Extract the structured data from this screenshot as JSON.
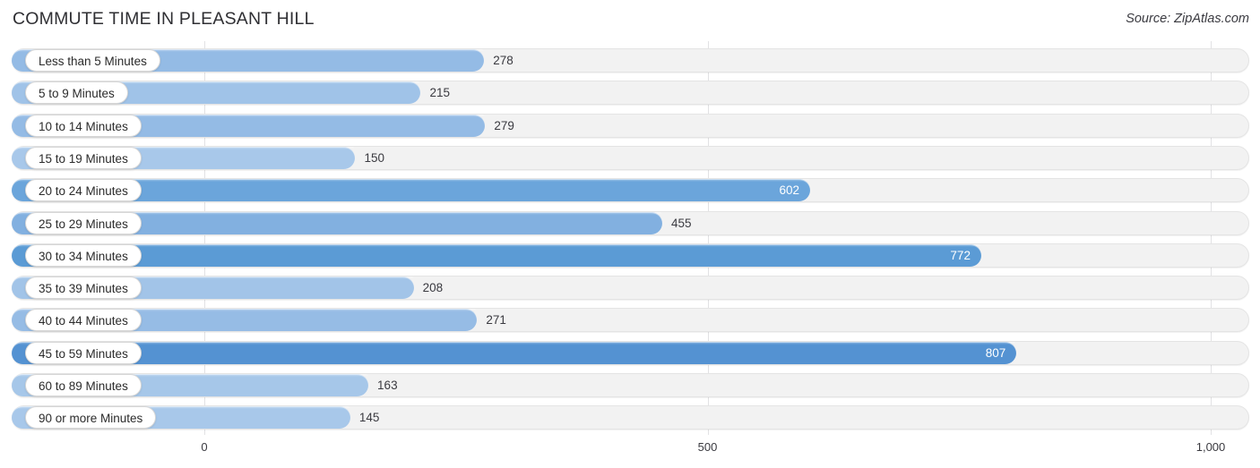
{
  "header": {
    "title": "COMMUTE TIME IN PLEASANT HILL",
    "source": "Source: ZipAtlas.com"
  },
  "chart_data": {
    "type": "bar",
    "orientation": "horizontal",
    "title": "COMMUTE TIME IN PLEASANT HILL",
    "source": "Source: ZipAtlas.com",
    "xlabel": "",
    "ylabel": "",
    "xlim": [
      0,
      1000
    ],
    "xticks": [
      0,
      500,
      1000
    ],
    "xtick_labels": [
      "0",
      "500",
      "1,000"
    ],
    "grid": true,
    "legend": false,
    "categories": [
      "Less than 5 Minutes",
      "5 to 9 Minutes",
      "10 to 14 Minutes",
      "15 to 19 Minutes",
      "20 to 24 Minutes",
      "25 to 29 Minutes",
      "30 to 34 Minutes",
      "35 to 39 Minutes",
      "40 to 44 Minutes",
      "45 to 59 Minutes",
      "60 to 89 Minutes",
      "90 or more Minutes"
    ],
    "values": [
      278,
      215,
      279,
      150,
      602,
      455,
      772,
      208,
      271,
      807,
      163,
      145
    ],
    "value_labels": [
      "278",
      "215",
      "279",
      "150",
      "602",
      "455",
      "772",
      "208",
      "271",
      "807",
      "163",
      "145"
    ],
    "bar_colors": [
      "#94bbe5",
      "#a0c3e8",
      "#94bbe5",
      "#a8c8ea",
      "#6ba5db",
      "#82b0e0",
      "#5b9bd5",
      "#a2c4e8",
      "#96bce5",
      "#5492d2",
      "#a6c7e9",
      "#a8c8ea"
    ],
    "label_inside": [
      false,
      false,
      false,
      false,
      true,
      false,
      true,
      false,
      false,
      true,
      false,
      false
    ]
  }
}
